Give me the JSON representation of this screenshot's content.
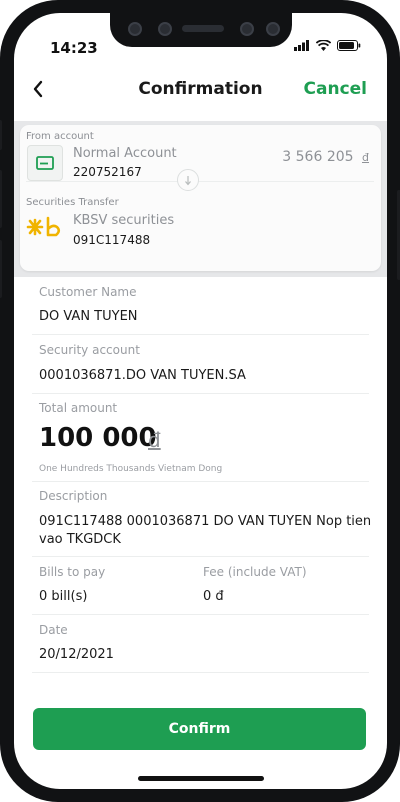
{
  "status_bar": {
    "time": "14:23"
  },
  "header": {
    "back_symbol": "<",
    "title": "Confirmation",
    "cancel_label": "Cancel"
  },
  "from_account": {
    "label": "From account",
    "name": "Normal Account",
    "number": "220752167",
    "balance": "3 566 205",
    "currency": "đ"
  },
  "to_account": {
    "label": "Securities Transfer",
    "name": "KBSV securities",
    "number": "091C117488"
  },
  "details": {
    "customer_name_label": "Customer Name",
    "customer_name": "DO VAN TUYEN",
    "security_account_label": "Security account",
    "security_account": "0001036871.DO VAN TUYEN.SA",
    "total_amount_label": "Total amount",
    "total_amount": "100 000",
    "total_currency": "đ",
    "amount_in_words": "One Hundreds Thousands Vietnam Dong",
    "description_label": "Description",
    "description": "091C117488 0001036871 DO VAN TUYEN Nop tien vao TKGDCK",
    "bills_label": "Bills to pay",
    "bills_value": "0 bill(s)",
    "fee_label": "Fee (include VAT)",
    "fee_value": "0 đ",
    "date_label": "Date",
    "date_value": "20/12/2021"
  },
  "confirm_label": "Confirm",
  "colors": {
    "accent": "#1e9e52",
    "card_bg": "#e6e7e9",
    "label": "#9a9da2"
  },
  "icons": [
    "back-icon",
    "signal-icon",
    "wifi-icon",
    "battery-icon",
    "bank-card-icon",
    "arrow-down-icon",
    "kbsv-logo"
  ]
}
